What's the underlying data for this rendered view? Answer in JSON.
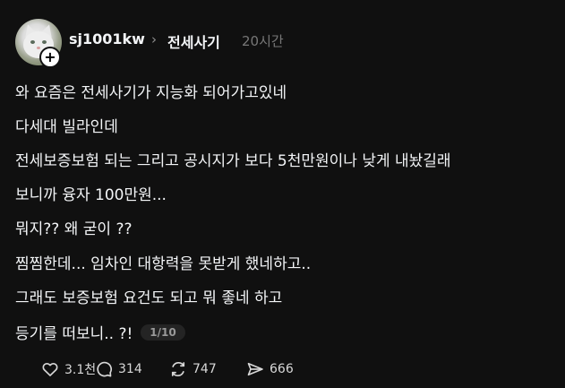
{
  "header": {
    "username": "sj1001kw",
    "chevron": "›",
    "community": "전세사기",
    "timestamp": "20시간",
    "follow_badge": "+",
    "avatar_icon": "cat-avatar"
  },
  "post": {
    "lines": [
      "와 요즘은 전세사기가 지능화 되어가고있네",
      "다세대 빌라인데",
      "전세보증보험 되는 그리고 공시지가 보다 5천만원이나 낮게 내놨길래",
      "보니까 융자 100만원...",
      "뭐지?? 왜 굳이 ??",
      "찜찜한데... 임차인 대항력을 못받게 했네하고..",
      "그래도 보증보험 요건도 되고 뭐 좋네 하고",
      "등기를 떠보니.. ?!"
    ],
    "page_indicator": "1/10"
  },
  "actions": {
    "like_count": "3.1천",
    "comment_count": "314",
    "repost_count": "747",
    "share_count": "666",
    "icons": [
      "heart-icon",
      "comment-icon",
      "repost-icon",
      "share-icon"
    ]
  },
  "colors": {
    "background": "#101010",
    "text": "#f3f5f7",
    "muted": "#777777",
    "badge_bg": "#242424"
  }
}
